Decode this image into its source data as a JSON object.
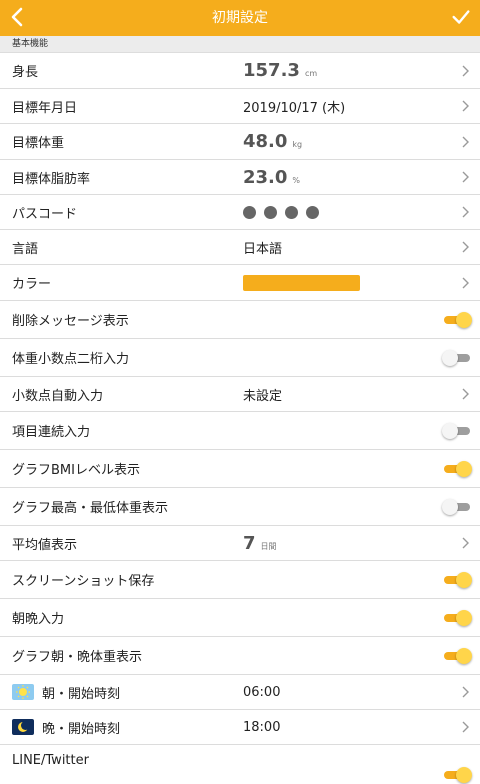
{
  "header": {
    "title": "初期設定"
  },
  "section_label": "基本機能",
  "rows": {
    "height": {
      "label": "身長",
      "value": "157.3",
      "unit": "cm"
    },
    "target_date": {
      "label": "目標年月日",
      "value": "2019/10/17 (木)"
    },
    "target_weight": {
      "label": "目標体重",
      "value": "48.0",
      "unit": "kg"
    },
    "target_fat": {
      "label": "目標体脂肪率",
      "value": "23.0",
      "unit": "%"
    },
    "passcode": {
      "label": "パスコード"
    },
    "language": {
      "label": "言語",
      "value": "日本語"
    },
    "color": {
      "label": "カラー",
      "value": "#f5ad1c"
    },
    "delete_msg": {
      "label": "削除メッセージ表示",
      "on": true
    },
    "decimal2": {
      "label": "体重小数点二桁入力",
      "on": false
    },
    "auto_decimal": {
      "label": "小数点自動入力",
      "value": "未設定"
    },
    "continuous": {
      "label": "項目連続入力",
      "on": false
    },
    "bmi_level": {
      "label": "グラフBMIレベル表示",
      "on": true
    },
    "max_min": {
      "label": "グラフ最高・最低体重表示",
      "on": false
    },
    "average": {
      "label": "平均値表示",
      "value": "7",
      "unit": "日間"
    },
    "screenshot": {
      "label": "スクリーンショット保存",
      "on": true
    },
    "morning_eve": {
      "label": "朝晩入力",
      "on": true
    },
    "graph_me": {
      "label": "グラフ朝・晩体重表示",
      "on": true
    },
    "morning_start": {
      "label": "朝・開始時刻",
      "value": "06:00",
      "icon": "sun-icon"
    },
    "evening_start": {
      "label": "晩・開始時刻",
      "value": "18:00",
      "icon": "moon-icon"
    },
    "line_twitter": {
      "label": "LINE/Twitter",
      "on": true
    }
  },
  "colors": {
    "accent": "#f5ad1c"
  }
}
